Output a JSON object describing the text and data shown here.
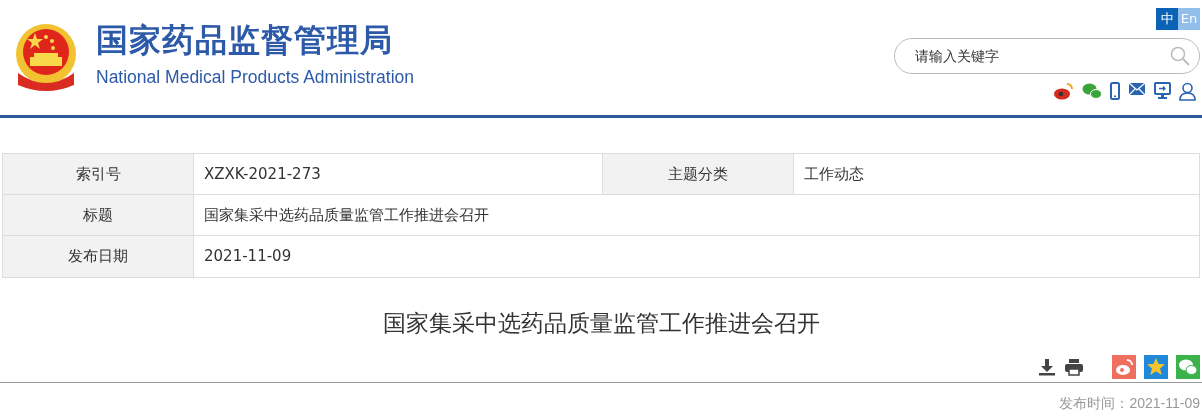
{
  "header": {
    "title": "国家药品监督管理局",
    "subtitle": "National Medical Products Administration"
  },
  "languages": [
    {
      "label": "中",
      "selected": true
    },
    {
      "label": "En",
      "selected": false
    }
  ],
  "search": {
    "placeholder": "请输入关键字"
  },
  "meta_table": {
    "rows": [
      {
        "cells": [
          {
            "label": "索引号",
            "value": "XZXK-2021-273"
          },
          {
            "label": "主题分类",
            "value": "工作动态"
          }
        ]
      },
      {
        "cells": [
          {
            "label": "标题",
            "value": "国家集采中选药品质量监管工作推进会召开"
          }
        ]
      },
      {
        "cells": [
          {
            "label": "发布日期",
            "value": "2021-11-09"
          }
        ]
      }
    ]
  },
  "article": {
    "title": "国家集采中选药品质量监管工作推进会召开",
    "publish_label": "发布时间：",
    "publish_date": "2021-11-09"
  }
}
